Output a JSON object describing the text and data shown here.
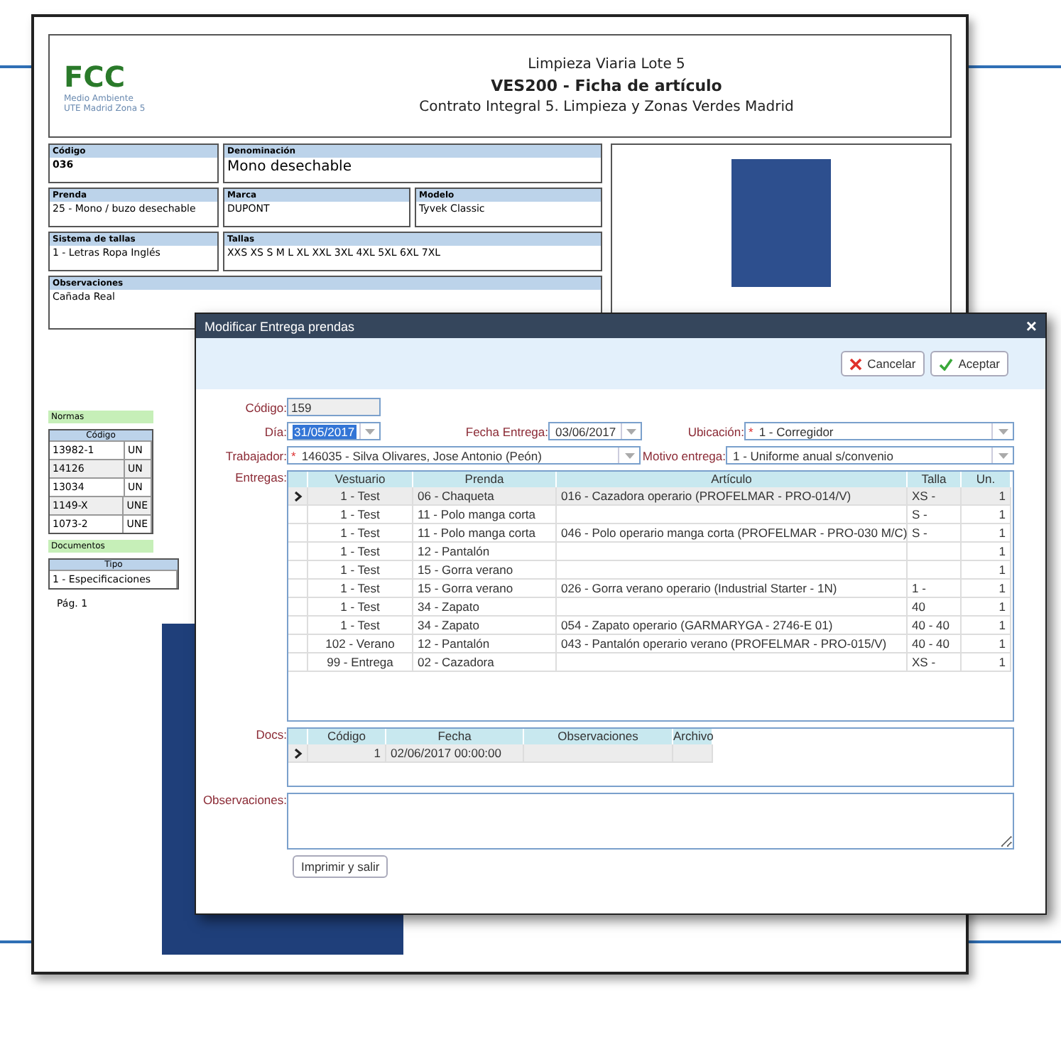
{
  "document": {
    "logo": "FCC",
    "logo_sub": "Medio Ambiente",
    "org": "UTE Madrid Zona 5",
    "lines": [
      "Limpieza Viaria Lote 5",
      "VES200 - Ficha de artículo",
      "Contrato Integral 5. Limpieza y Zonas Verdes Madrid"
    ],
    "field_rows": [
      [
        {
          "label": "Código",
          "value": "036"
        },
        {
          "label": "Denominación",
          "value": "Mono desechable"
        }
      ],
      [
        {
          "label": "Prenda",
          "value": "25 - Mono / buzo desechable"
        },
        {
          "label": "Marca",
          "value": "DUPONT"
        },
        {
          "label": "Modelo",
          "value": "Tyvek Classic"
        }
      ],
      [
        {
          "label": "Sistema de tallas",
          "value": "1 - Letras Ropa Inglés"
        },
        {
          "label": "Tallas",
          "value": "XXS XS S M L XL XXL 3XL 4XL 5XL 6XL 7XL"
        }
      ],
      [
        {
          "label": "Observaciones",
          "value": "Cañada Real"
        }
      ]
    ],
    "normas": {
      "title": "Normas",
      "column": "Código",
      "rows": [
        [
          "13982-1",
          "UN"
        ],
        [
          "14126",
          "UN"
        ],
        [
          "13034",
          "UN"
        ],
        [
          "1149-X",
          "UNE"
        ],
        [
          "1073-2",
          "UNE"
        ]
      ]
    },
    "documentos": {
      "title": "Documentos",
      "column": "Tipo",
      "rows": [
        "1 - Especificaciones"
      ],
      "page": "Pág. 1"
    }
  },
  "dialog": {
    "title": "Modificar Entrega prendas",
    "close": "×",
    "required_mark": "*",
    "buttons": [
      {
        "kind": "cancel",
        "label": "Cancelar"
      },
      {
        "kind": "accept",
        "label": "Aceptar"
      }
    ],
    "codigo": {
      "label": "Código:",
      "value": "159",
      "disabled": true
    },
    "dia": {
      "label": "Día:",
      "value": "31/05/2017",
      "highlighted": true
    },
    "fecha": {
      "label": "Fecha Entrega:",
      "value": "03/06/2017"
    },
    "ubicacion": {
      "label": "Ubicación:",
      "value": "1 - Corregidor",
      "required": true
    },
    "trabajador": {
      "label": "Trabajador:",
      "value": "146035 - Silva Olivares, Jose Antonio (Peón)",
      "required": true
    },
    "motivo": {
      "label": "Motivo entrega:",
      "value": "1 - Uniforme anual s/convenio",
      "required": false
    },
    "entregas": {
      "label": "Entregas:",
      "columns": [
        "Vestuario",
        "Prenda",
        "Artículo",
        "Talla",
        "Un."
      ],
      "rows": [
        {
          "cells": [
            "1 - Test",
            "06 - Chaqueta",
            "016 - Cazadora operario (PROFELMAR - PRO-014/V)",
            "XS -",
            "1"
          ],
          "selected": true
        },
        {
          "cells": [
            "1 - Test",
            "11 - Polo manga corta",
            "",
            "S -",
            "1"
          ],
          "selected": false
        },
        {
          "cells": [
            "1 - Test",
            "11 - Polo manga corta",
            "046 - Polo operario manga corta (PROFELMAR - PRO-030 M/C)",
            "S -",
            "1"
          ],
          "selected": false
        },
        {
          "cells": [
            "1 - Test",
            "12 - Pantalón",
            "",
            "",
            "1"
          ],
          "selected": false
        },
        {
          "cells": [
            "1 - Test",
            "15 - Gorra verano",
            "",
            "",
            "1"
          ],
          "selected": false
        },
        {
          "cells": [
            "1 - Test",
            "15 - Gorra verano",
            "026 - Gorra verano operario (Industrial Starter - 1N)",
            "1 -",
            "1"
          ],
          "selected": false
        },
        {
          "cells": [
            "1 - Test",
            "34 - Zapato",
            "",
            "40",
            "1"
          ],
          "selected": false
        },
        {
          "cells": [
            "1 - Test",
            "34 - Zapato",
            "054 - Zapato operario (GARMARYGA - 2746-E 01)",
            "40 - 40",
            "1"
          ],
          "selected": false
        },
        {
          "cells": [
            "102 - Verano",
            "12 - Pantalón",
            "043 - Pantalón operario verano (PROFELMAR - PRO-015/V)",
            "40 - 40",
            "1"
          ],
          "selected": false
        },
        {
          "cells": [
            "99 - Entrega",
            "02 - Cazadora",
            "",
            "XS -",
            "1"
          ],
          "selected": false
        }
      ]
    },
    "docs": {
      "label": "Docs:",
      "columns": [
        "Código",
        "Fecha",
        "Observaciones",
        "Archivo"
      ],
      "rows": [
        {
          "cells": [
            "1",
            "02/06/2017 00:00:00",
            "",
            ""
          ],
          "selected": true
        }
      ]
    },
    "observaciones": {
      "label": "Observaciones:"
    },
    "print_button": "Imprimir y salir"
  }
}
